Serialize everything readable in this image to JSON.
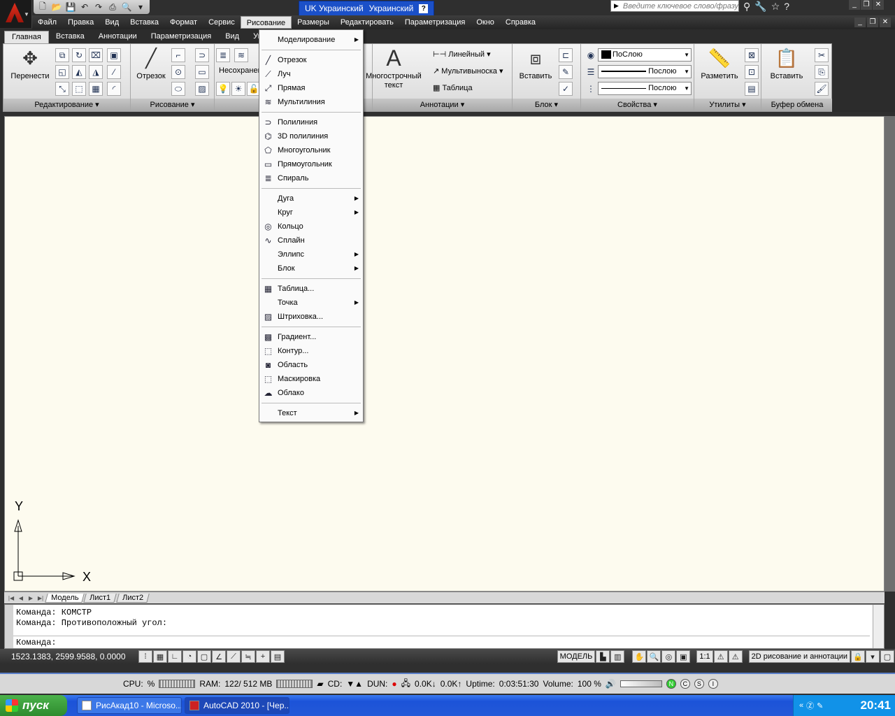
{
  "app_button": {
    "icon": "autocad-logo-icon"
  },
  "quick_access": {
    "items": [
      "new-icon",
      "open-icon",
      "save-icon",
      "undo-icon",
      "redo-icon",
      "plot-icon",
      "preview-icon",
      "customize-icon"
    ]
  },
  "language_bar": {
    "lang_code": "UK Украинский",
    "keyboard": "Украинский",
    "help": "?"
  },
  "search": {
    "placeholder": "Введите ключевое слово/фразу"
  },
  "menubar": {
    "items": [
      "Файл",
      "Правка",
      "Вид",
      "Вставка",
      "Формат",
      "Сервис",
      "Рисование",
      "Размеры",
      "Редактировать",
      "Параметризация",
      "Окно",
      "Справка"
    ],
    "active": "Рисование"
  },
  "ribbon_tabs": {
    "items": [
      "Главная",
      "Вставка",
      "Аннотации",
      "Параметризация",
      "Вид",
      "Упр"
    ],
    "active": "Главная"
  },
  "ribbon": {
    "edit_panel": {
      "title": "Редактирование",
      "move_label": "Перенести"
    },
    "draw_panel": {
      "title": "Рисование",
      "line_label": "Отрезок"
    },
    "layers_panel": {
      "unsaved_label": "Несохранен"
    },
    "annot_panel": {
      "title": "Аннотации",
      "mtext_label": "Многострочный текст",
      "linear_label": "Линейный",
      "mleader_label": "Мультивыноска",
      "table_label": "Таблица"
    },
    "block_panel": {
      "title": "Блок",
      "insert_label": "Вставить"
    },
    "props_panel": {
      "title": "Свойства",
      "color": "ПоСлою",
      "linetype": "Послою",
      "lineweight": "Послою"
    },
    "util_panel": {
      "title": "Утилиты",
      "measure_label": "Разметить"
    },
    "clip_panel": {
      "title": "Буфер обмена",
      "paste_label": "Вставить"
    }
  },
  "draw_menu": [
    {
      "label": "Моделирование",
      "icon": "",
      "submenu": true
    },
    {
      "sep": true
    },
    {
      "label": "Отрезок",
      "icon": "line-icon"
    },
    {
      "label": "Луч",
      "icon": "ray-icon"
    },
    {
      "label": "Прямая",
      "icon": "xline-icon"
    },
    {
      "label": "Мультилиния",
      "icon": "mline-icon"
    },
    {
      "sep": true
    },
    {
      "label": "Полилиния",
      "icon": "polyline-icon"
    },
    {
      "label": "3D полилиния",
      "icon": "3dpolyline-icon"
    },
    {
      "label": "Многоугольник",
      "icon": "polygon-icon"
    },
    {
      "label": "Прямоугольник",
      "icon": "rectangle-icon"
    },
    {
      "label": "Спираль",
      "icon": "helix-icon"
    },
    {
      "sep": true
    },
    {
      "label": "Дуга",
      "icon": "",
      "submenu": true
    },
    {
      "label": "Круг",
      "icon": "",
      "submenu": true
    },
    {
      "label": "Кольцо",
      "icon": "donut-icon"
    },
    {
      "label": "Сплайн",
      "icon": "spline-icon"
    },
    {
      "label": "Эллипс",
      "icon": "",
      "submenu": true
    },
    {
      "label": "Блок",
      "icon": "",
      "submenu": true
    },
    {
      "sep": true
    },
    {
      "label": "Таблица...",
      "icon": "table-icon"
    },
    {
      "label": "Точка",
      "icon": "",
      "submenu": true
    },
    {
      "label": "Штриховка...",
      "icon": "hatch-icon"
    },
    {
      "sep": true
    },
    {
      "label": "Градиент...",
      "icon": "gradient-icon"
    },
    {
      "label": "Контур...",
      "icon": "boundary-icon"
    },
    {
      "label": "Область",
      "icon": "region-icon"
    },
    {
      "label": "Маскировка",
      "icon": "wipeout-icon"
    },
    {
      "label": "Облако",
      "icon": "revcloud-icon"
    },
    {
      "sep": true
    },
    {
      "label": "Текст",
      "icon": "",
      "submenu": true
    }
  ],
  "ucs": {
    "x_label": "X",
    "y_label": "Y"
  },
  "layout_tabs": {
    "items": [
      "Модель",
      "Лист1",
      "Лист2"
    ],
    "active": "Модель"
  },
  "command": {
    "history": [
      "Команда: КОМСТР",
      "Команда: Противоположный угол:"
    ],
    "prompt": "Команда:"
  },
  "status": {
    "coords": "1523.1383, 2599.9588, 0.0000",
    "model_label": "МОДЕЛЬ",
    "scale": "1:1",
    "workspace": "2D рисование и аннотации"
  },
  "perf": {
    "cpu_label": "CPU:",
    "cpu_value": "%",
    "ram_label": "RAM:",
    "ram_value": "122/ 512 MB",
    "cd_label": "CD:",
    "dun_label": "DUN:",
    "net_down": "0.0K",
    "net_up": "0.0K",
    "uptime_label": "Uptime:",
    "uptime_value": "0:03:51:30",
    "volume_label": "Volume:",
    "volume_value": "100 %"
  },
  "taskbar": {
    "start_label": "пуск",
    "tasks": [
      "РисАкад10 - Microso...",
      "AutoCAD 2010 - [Чер..."
    ],
    "active_task": 1,
    "clock": "20:41"
  }
}
